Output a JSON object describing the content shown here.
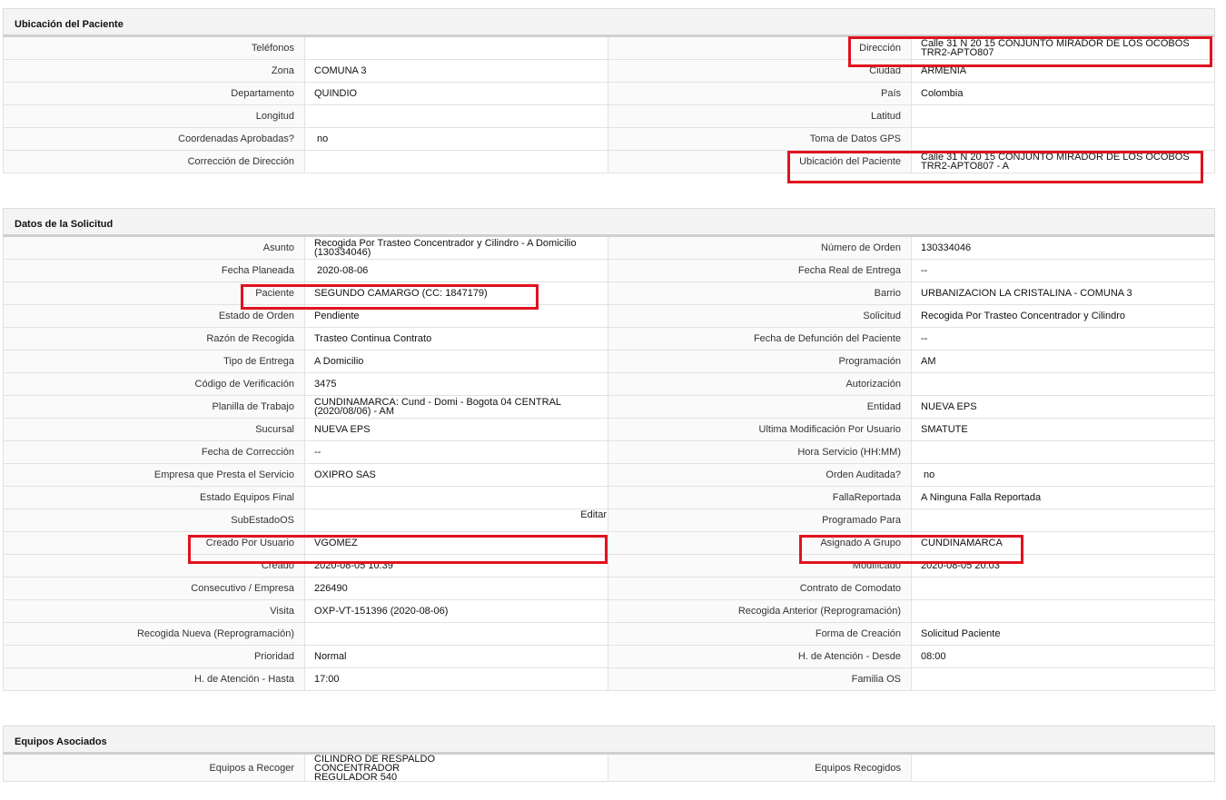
{
  "sections": {
    "ubicacion": {
      "title": "Ubicación del Paciente",
      "rows": [
        {
          "l1": "Teléfonos",
          "v1": "",
          "l2": "Dirección",
          "v2": "Calle 31 N 20 15 CONJUNTO MIRADOR DE LOS OCOBOS\nTRR2-APTO807"
        },
        {
          "l1": "Zona",
          "v1": "COMUNA 3",
          "l2": "Ciudad",
          "v2": "ARMENIA"
        },
        {
          "l1": "Departamento",
          "v1": "QUINDIO",
          "l2": "País",
          "v2": "Colombia"
        },
        {
          "l1": "Longitud",
          "v1": "",
          "l2": "Latitud",
          "v2": ""
        },
        {
          "l1": "Coordenadas Aprobadas?",
          "v1": "no",
          "l2": "Toma de Datos GPS",
          "v2": ""
        },
        {
          "l1": "Corrección de Dirección",
          "v1": "",
          "l2": "Ubicación del Paciente",
          "v2": "Calle 31 N 20 15 CONJUNTO MIRADOR DE LOS OCOBOS\nTRR2-APTO807 - A"
        }
      ]
    },
    "solicitud": {
      "title": "Datos de la Solicitud",
      "edit_label": "Editar",
      "rows": [
        {
          "l1": "Asunto",
          "v1": "Recogida Por Trasteo Concentrador y Cilindro - A Domicilio\n(130334046)",
          "l2": "Número de Orden",
          "v2": "130334046"
        },
        {
          "l1": "Fecha Planeada",
          "v1": "2020-08-06",
          "l2": "Fecha Real de Entrega",
          "v2": "--"
        },
        {
          "l1": "Paciente",
          "v1": "SEGUNDO CAMARGO (CC: 1847179)",
          "l2": "Barrio",
          "v2": "URBANIZACION LA CRISTALINA - COMUNA 3"
        },
        {
          "l1": "Estado de Orden",
          "v1": "Pendiente",
          "l2": "Solicitud",
          "v2": "Recogida Por Trasteo Concentrador y Cilindro"
        },
        {
          "l1": "Razón de Recogida",
          "v1": "Trasteo Continua Contrato",
          "l2": "Fecha de Defunción del Paciente",
          "v2": "--"
        },
        {
          "l1": "Tipo de Entrega",
          "v1": "A Domicilio",
          "l2": "Programación",
          "v2": "AM"
        },
        {
          "l1": "Código de Verificación",
          "v1": "3475",
          "l2": "Autorización",
          "v2": ""
        },
        {
          "l1": "Planilla de Trabajo",
          "v1": "CUNDINAMARCA: Cund - Domi - Bogota 04 CENTRAL\n(2020/08/06) - AM",
          "l2": "Entidad",
          "v2": "NUEVA EPS"
        },
        {
          "l1": "Sucursal",
          "v1": "NUEVA EPS",
          "l2": "Ultima Modificación Por Usuario",
          "v2": "SMATUTE"
        },
        {
          "l1": "Fecha de Corrección",
          "v1": "--",
          "l2": "Hora Servicio (HH:MM)",
          "v2": ""
        },
        {
          "l1": "Empresa que Presta el Servicio",
          "v1": "OXIPRO SAS",
          "l2": "Orden Auditada?",
          "v2": "no"
        },
        {
          "l1": "Estado Equipos Final",
          "v1": "",
          "l2": "FallaReportada",
          "v2": "A Ninguna Falla Reportada"
        },
        {
          "l1": "SubEstadoOS",
          "v1": "",
          "l2": "Programado Para",
          "v2": ""
        },
        {
          "l1": "Creado Por Usuario",
          "v1": "VGOMEZ",
          "l2": "Asignado A Grupo",
          "v2": "CUNDINAMARCA"
        },
        {
          "l1": "Creado",
          "v1": "2020-08-05 10:39",
          "l2": "Modificado",
          "v2": "2020-08-05 20:03"
        },
        {
          "l1": "Consecutivo / Empresa",
          "v1": "226490",
          "l2": "Contrato de Comodato",
          "v2": ""
        },
        {
          "l1": "Visita",
          "v1": "OXP-VT-151396 (2020-08-06)",
          "l2": "Recogida Anterior (Reprogramación)",
          "v2": ""
        },
        {
          "l1": "Recogida Nueva (Reprogramación)",
          "v1": "",
          "l2": "Forma de Creación",
          "v2": "Solicitud Paciente"
        },
        {
          "l1": "Prioridad",
          "v1": "Normal",
          "l2": "H. de Atención - Desde",
          "v2": "08:00"
        },
        {
          "l1": "H. de Atención - Hasta",
          "v1": "17:00",
          "l2": "Familia OS",
          "v2": ""
        }
      ]
    },
    "equipos": {
      "title": "Equipos Asociados",
      "rows": [
        {
          "l1": "Equipos a Recoger",
          "v1": "CILINDRO DE RESPALDO\nCONCENTRADOR\nREGULADOR 540",
          "l2": "Equipos Recogidos",
          "v2": ""
        }
      ]
    }
  },
  "colors": {
    "highlight": "#e0121f",
    "header_bg": "#f4f4f4",
    "border": "#e2e2e2"
  }
}
